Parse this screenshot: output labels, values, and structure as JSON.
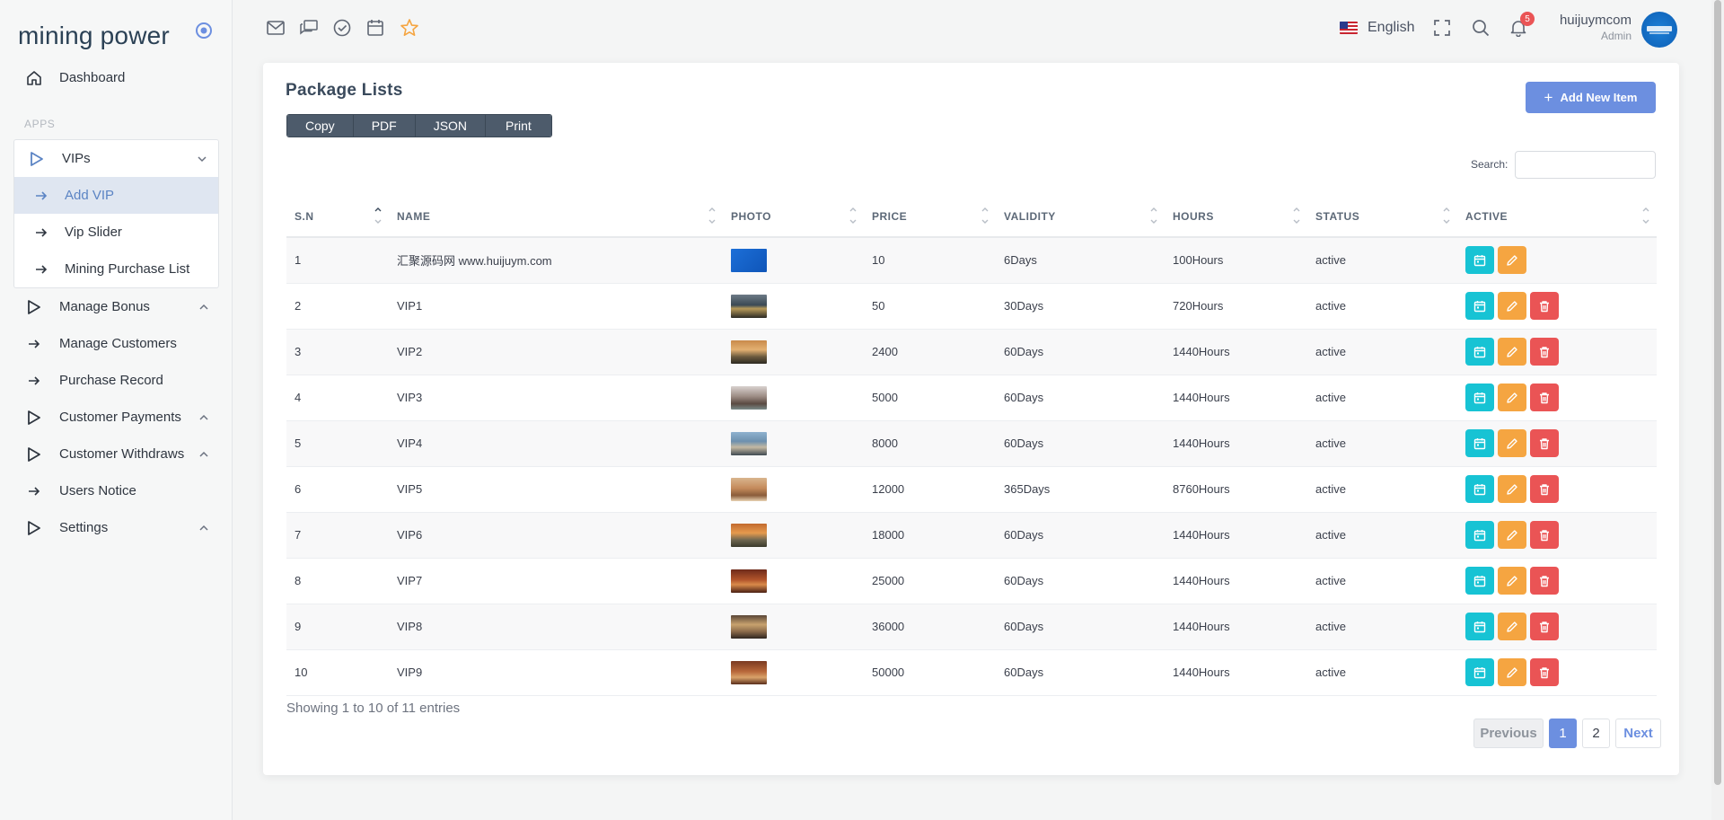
{
  "brand": "mining power",
  "sidebar": {
    "dashboard": "Dashboard",
    "section_label": "APPS",
    "vips": {
      "label": "VIPs",
      "children": [
        "Add VIP",
        "Vip Slider",
        "Mining Purchase List"
      ]
    },
    "items": [
      {
        "label": "Manage Bonus",
        "icon": "play-outline-icon",
        "expandable": true
      },
      {
        "label": "Manage Customers",
        "icon": "arrow-right-icon",
        "expandable": false
      },
      {
        "label": "Purchase Record",
        "icon": "arrow-right-icon",
        "expandable": false
      },
      {
        "label": "Customer Payments",
        "icon": "play-outline-icon",
        "expandable": true
      },
      {
        "label": "Customer Withdraws",
        "icon": "play-outline-icon",
        "expandable": true
      },
      {
        "label": "Users Notice",
        "icon": "arrow-right-icon",
        "expandable": false
      },
      {
        "label": "Settings",
        "icon": "play-outline-icon",
        "expandable": true
      }
    ]
  },
  "topbar": {
    "icons": [
      "mail-icon",
      "chat-icon",
      "check-circle-icon",
      "calendar-icon",
      "star-icon"
    ],
    "language": "English",
    "notification_count": "5",
    "user_name": "huijuymcom",
    "user_role": "Admin"
  },
  "card": {
    "title": "Package Lists",
    "export_buttons": [
      "Copy",
      "PDF",
      "JSON",
      "Print"
    ],
    "add_button": "Add New Item",
    "search_label": "Search:",
    "search_value": ""
  },
  "table": {
    "columns": [
      "S.N",
      "NAME",
      "PHOTO",
      "PRICE",
      "VALIDITY",
      "HOURS",
      "STATUS",
      "ACTIVE"
    ],
    "rows": [
      {
        "sn": "1",
        "name": "汇聚源码网 www.huijuym.com",
        "price": "10",
        "validity": "6Days",
        "hours": "100Hours",
        "status": "active",
        "photo": "logo",
        "deletable": false
      },
      {
        "sn": "2",
        "name": "VIP1",
        "price": "50",
        "validity": "30Days",
        "hours": "720Hours",
        "status": "active",
        "photo": "landscape-1",
        "deletable": true
      },
      {
        "sn": "3",
        "name": "VIP2",
        "price": "2400",
        "validity": "60Days",
        "hours": "1440Hours",
        "status": "active",
        "photo": "landscape-2",
        "deletable": true
      },
      {
        "sn": "4",
        "name": "VIP3",
        "price": "5000",
        "validity": "60Days",
        "hours": "1440Hours",
        "status": "active",
        "photo": "landscape-3",
        "deletable": true
      },
      {
        "sn": "5",
        "name": "VIP4",
        "price": "8000",
        "validity": "60Days",
        "hours": "1440Hours",
        "status": "active",
        "photo": "landscape-4",
        "deletable": true
      },
      {
        "sn": "6",
        "name": "VIP5",
        "price": "12000",
        "validity": "365Days",
        "hours": "8760Hours",
        "status": "active",
        "photo": "landscape-5",
        "deletable": true
      },
      {
        "sn": "7",
        "name": "VIP6",
        "price": "18000",
        "validity": "60Days",
        "hours": "1440Hours",
        "status": "active",
        "photo": "landscape-6",
        "deletable": true
      },
      {
        "sn": "8",
        "name": "VIP7",
        "price": "25000",
        "validity": "60Days",
        "hours": "1440Hours",
        "status": "active",
        "photo": "landscape-7",
        "deletable": true
      },
      {
        "sn": "9",
        "name": "VIP8",
        "price": "36000",
        "validity": "60Days",
        "hours": "1440Hours",
        "status": "active",
        "photo": "landscape-8",
        "deletable": true
      },
      {
        "sn": "10",
        "name": "VIP9",
        "price": "50000",
        "validity": "60Days",
        "hours": "1440Hours",
        "status": "active",
        "photo": "landscape-9",
        "deletable": true
      }
    ]
  },
  "pagination": {
    "info": "Showing 1 to 10 of 11 entries",
    "previous": "Previous",
    "pages": [
      "1",
      "2"
    ],
    "active_page": "1",
    "next": "Next"
  },
  "colors": {
    "accent": "#6c8fe0",
    "view": "#17c3d4",
    "edit": "#f5a541",
    "delete": "#ea5455"
  }
}
